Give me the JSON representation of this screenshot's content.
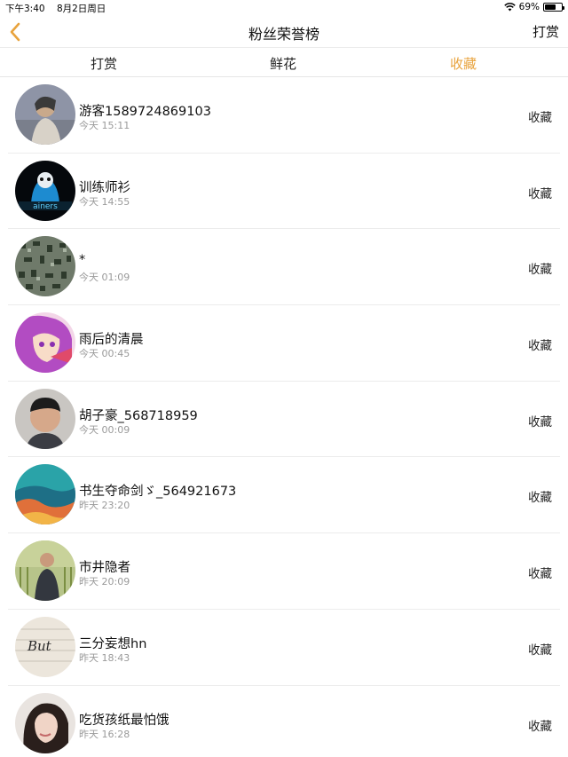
{
  "status_bar": {
    "time": "下午3:40",
    "date": "8月2日周日",
    "battery_text": "69%",
    "battery_level": 0.69,
    "wifi_icon": "wifi-icon"
  },
  "nav": {
    "back_icon": "chevron-left-icon",
    "title": "粉丝荣誉榜",
    "action": "打赏",
    "accent": "#e8a33d"
  },
  "tabs": [
    {
      "label": "打赏",
      "active": false
    },
    {
      "label": "鲜花",
      "active": false
    },
    {
      "label": "收藏",
      "active": true
    }
  ],
  "rows": [
    {
      "name": "游客1589724869103",
      "time": "今天 15:11",
      "gift": "收藏"
    },
    {
      "name": "训练师衫",
      "time": "今天 14:55",
      "gift": "收藏"
    },
    {
      "name": "*",
      "time": "今天 01:09",
      "gift": "收藏"
    },
    {
      "name": "雨后的清晨",
      "time": "今天 00:45",
      "gift": "收藏"
    },
    {
      "name": "胡子豪_568718959",
      "time": "今天 00:09",
      "gift": "收藏"
    },
    {
      "name": "书生夺命剑ゞ_564921673",
      "time": "昨天 23:20",
      "gift": "收藏"
    },
    {
      "name": "市井隐者",
      "time": "昨天 20:09",
      "gift": "收藏"
    },
    {
      "name": "三分妄想hn",
      "time": "昨天 18:43",
      "gift": "收藏"
    },
    {
      "name": "吃货孩纸最怕饿",
      "time": "昨天 16:28",
      "gift": "收藏"
    }
  ]
}
